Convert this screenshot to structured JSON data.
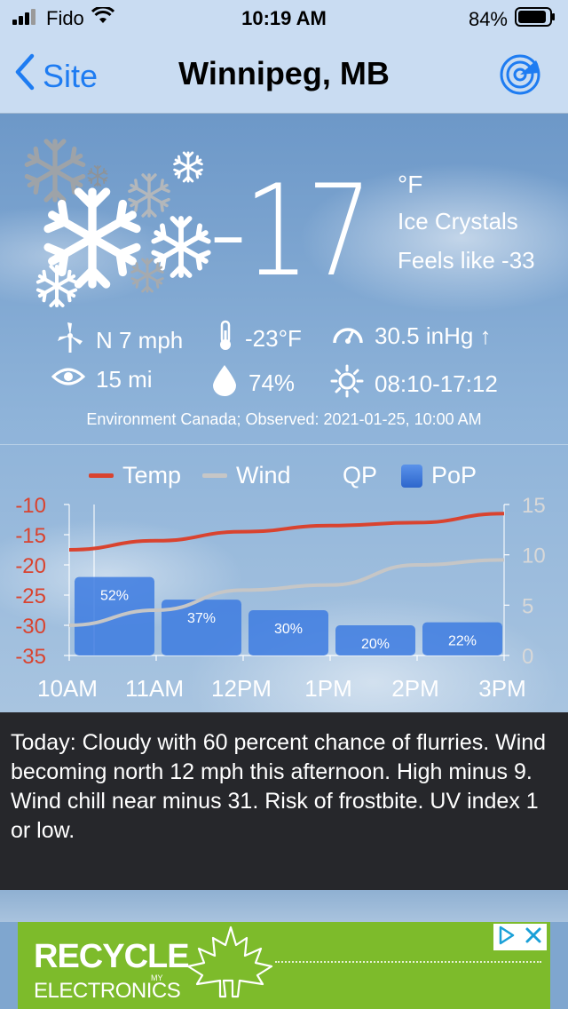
{
  "status_bar": {
    "carrier": "Fido",
    "time": "10:19 AM",
    "battery": "84%"
  },
  "nav": {
    "back_label": "Site",
    "title": "Winnipeg, MB"
  },
  "current": {
    "temperature": "-17",
    "unit": "°F",
    "condition": "Ice Crystals",
    "feels_like": "Feels like -33"
  },
  "observations": {
    "wind": "N 7 mph",
    "dewpoint": "-23°F",
    "pressure": "30.5 inHg ↑",
    "visibility": "15 mi",
    "humidity": "74%",
    "sun": "08:10-17:12"
  },
  "source_line": "Environment Canada; Observed: 2021-01-25, 10:00 AM",
  "legend": {
    "temp": "Temp",
    "wind": "Wind",
    "qp": "QP",
    "pop": "PoP"
  },
  "colors": {
    "temp_line": "#d9432f",
    "wind_line": "#c6c6c6",
    "pop_bar": "#3d7be0",
    "left_axis": "#d9432f",
    "right_axis": "#d8d8d8"
  },
  "chart_data": {
    "type": "bar",
    "categories": [
      "10AM",
      "11AM",
      "12PM",
      "1PM",
      "2PM",
      "3PM"
    ],
    "pop_labels": [
      "52%",
      "37%",
      "30%",
      "20%",
      "22%"
    ],
    "pop_values": [
      52,
      37,
      30,
      20,
      22
    ],
    "temp_x": [
      0,
      1,
      2,
      3,
      4,
      5
    ],
    "temp_values": [
      -17.5,
      -16,
      -14.5,
      -13.5,
      -13,
      -11.5
    ],
    "wind_x": [
      0,
      1,
      2,
      3,
      4,
      5
    ],
    "wind_values": [
      3,
      4.5,
      6.5,
      7,
      9,
      9.5
    ],
    "left_axis_ticks": [
      "-10",
      "-15",
      "-20",
      "-25",
      "-30",
      "-35"
    ],
    "left_ylim": [
      -35,
      -10
    ],
    "right_axis_ticks": [
      "15",
      "10",
      "5",
      "0"
    ],
    "right_ylim": [
      0,
      15
    ]
  },
  "forecast_text": "Today:  Cloudy with 60 percent chance of flurries. Wind becoming north 12 mph this afternoon. High minus 9. Wind chill near minus 31. Risk of frostbite. UV index 1 or low.",
  "ad": {
    "brand_line1": "RECYCLE",
    "brand_small": "MY",
    "brand_line2": "ELECTRONICS"
  }
}
